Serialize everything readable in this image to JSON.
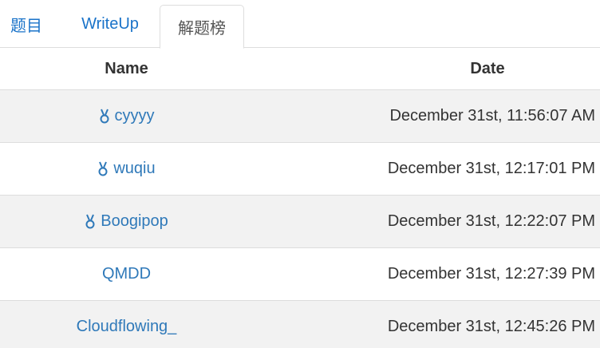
{
  "tabs": [
    {
      "label": "题目"
    },
    {
      "label": "WriteUp"
    },
    {
      "label": "解题榜"
    }
  ],
  "table": {
    "headers": {
      "name": "Name",
      "date": "Date"
    },
    "rows": [
      {
        "name": "cyyyy",
        "date": "December 31st, 11:56:07 AM",
        "medal": "medal-icon"
      },
      {
        "name": "wuqiu",
        "date": "December 31st, 12:17:01 PM",
        "medal": "medal-icon"
      },
      {
        "name": "Boogipop",
        "date": "December 31st, 12:22:07 PM",
        "medal": "medal-icon"
      },
      {
        "name": "QMDD",
        "date": "December 31st, 12:27:39 PM"
      },
      {
        "name": "Cloudflowing_",
        "date": "December 31st, 12:45:26 PM"
      }
    ]
  },
  "colors": {
    "link": "#2f79b9",
    "stripe": "#f2f2f2",
    "border": "#dddddd"
  }
}
